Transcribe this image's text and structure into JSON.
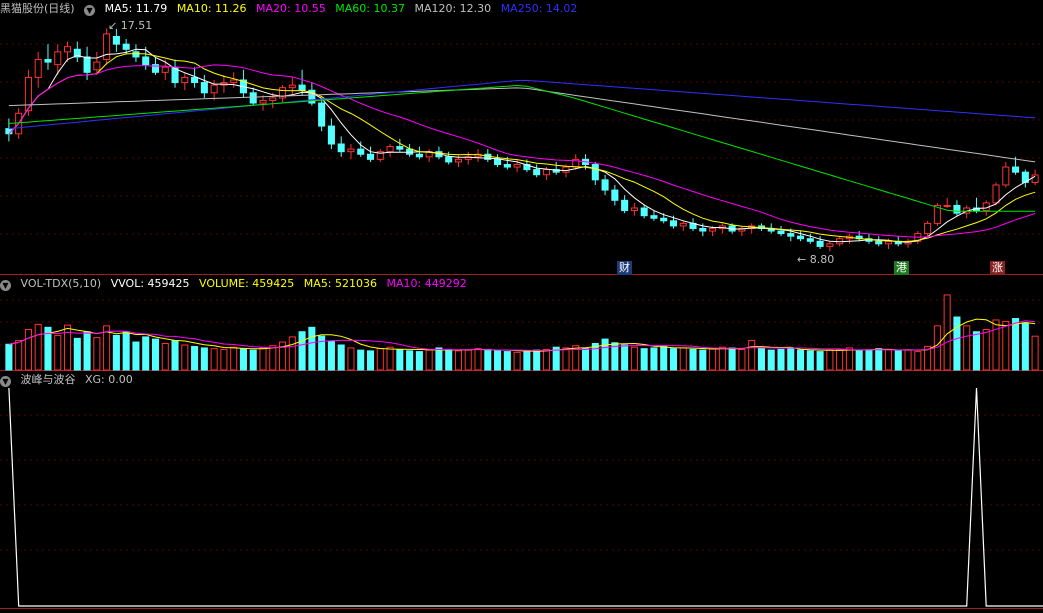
{
  "price_header": {
    "title": "黑猫股份(日线)",
    "ma5": "MA5: 11.79",
    "ma10": "MA10: 11.26",
    "ma20": "MA20: 10.55",
    "ma60": "MA60: 10.37",
    "ma120": "MA120: 12.30",
    "ma250": "MA250: 14.02"
  },
  "vol_header": {
    "title": "VOL-TDX(5,10)",
    "vvol": "VVOL: 459425",
    "volume": "VOLUME: 459425",
    "ma5": "MA5: 521036",
    "ma10": "MA10: 449292"
  },
  "ind_header": {
    "title": "波峰与波谷",
    "xg": "XG: 0.00"
  },
  "annotations": {
    "high_label": "17.51",
    "low_label": "8.80",
    "tag_cai": "财",
    "tag_gang": "港",
    "tag_zhang": "涨"
  },
  "colors": {
    "up": "#ff3232",
    "down": "#54ffff",
    "ma5": "#ffffff",
    "ma10": "#ffff00",
    "ma20": "#ff00ff",
    "ma60": "#00e600",
    "ma120": "#c0c0c0",
    "ma250": "#3030ff"
  },
  "chart_data": [
    {
      "type": "candlestick",
      "title": "黑猫股份(日线)",
      "annotations": {
        "high": 17.51,
        "low": 8.8
      },
      "ohlc": [
        [
          13.6,
          14.0,
          13.1,
          13.4
        ],
        [
          13.4,
          14.4,
          13.2,
          14.2
        ],
        [
          14.3,
          15.9,
          14.1,
          15.6
        ],
        [
          15.6,
          16.6,
          15.2,
          16.3
        ],
        [
          16.3,
          16.9,
          15.9,
          16.2
        ],
        [
          16.1,
          16.9,
          15.7,
          16.6
        ],
        [
          16.6,
          17.0,
          16.2,
          16.8
        ],
        [
          16.7,
          17.0,
          16.2,
          16.4
        ],
        [
          16.4,
          16.8,
          15.5,
          15.8
        ],
        [
          15.9,
          16.6,
          15.7,
          16.2
        ],
        [
          16.3,
          17.51,
          16.1,
          17.3
        ],
        [
          17.2,
          17.5,
          16.6,
          16.9
        ],
        [
          16.9,
          17.1,
          16.5,
          16.7
        ],
        [
          16.6,
          16.9,
          16.2,
          16.4
        ],
        [
          16.4,
          16.8,
          15.9,
          16.1
        ],
        [
          16.1,
          16.4,
          15.7,
          15.8
        ],
        [
          15.8,
          16.3,
          15.5,
          16.0
        ],
        [
          16.0,
          16.3,
          15.2,
          15.4
        ],
        [
          15.4,
          15.8,
          15.1,
          15.6
        ],
        [
          15.6,
          16.0,
          15.2,
          15.4
        ],
        [
          15.4,
          15.7,
          14.8,
          15.0
        ],
        [
          15.0,
          15.5,
          14.7,
          15.3
        ],
        [
          15.3,
          15.7,
          15.0,
          15.4
        ],
        [
          15.4,
          15.8,
          15.2,
          15.5
        ],
        [
          15.5,
          15.9,
          14.8,
          15.0
        ],
        [
          15.0,
          15.2,
          14.5,
          14.6
        ],
        [
          14.6,
          14.9,
          14.3,
          14.7
        ],
        [
          14.7,
          15.0,
          14.4,
          14.8
        ],
        [
          14.8,
          15.3,
          14.6,
          15.2
        ],
        [
          15.2,
          15.6,
          14.9,
          15.3
        ],
        [
          15.3,
          15.9,
          14.9,
          15.1
        ],
        [
          15.1,
          15.4,
          14.5,
          14.6
        ],
        [
          14.6,
          14.8,
          13.5,
          13.7
        ],
        [
          13.7,
          14.0,
          12.8,
          13.0
        ],
        [
          13.0,
          13.3,
          12.5,
          12.7
        ],
        [
          12.7,
          13.0,
          12.4,
          12.8
        ],
        [
          12.8,
          13.1,
          12.5,
          12.6
        ],
        [
          12.6,
          12.9,
          12.3,
          12.4
        ],
        [
          12.4,
          12.8,
          12.3,
          12.7
        ],
        [
          12.7,
          13.0,
          12.5,
          12.9
        ],
        [
          12.9,
          13.2,
          12.7,
          12.8
        ],
        [
          12.8,
          13.0,
          12.5,
          12.6
        ],
        [
          12.6,
          12.9,
          12.4,
          12.5
        ],
        [
          12.5,
          12.8,
          12.3,
          12.7
        ],
        [
          12.7,
          12.9,
          12.4,
          12.5
        ],
        [
          12.5,
          12.7,
          12.2,
          12.3
        ],
        [
          12.3,
          12.6,
          12.1,
          12.4
        ],
        [
          12.4,
          12.7,
          12.2,
          12.5
        ],
        [
          12.5,
          12.8,
          12.3,
          12.6
        ],
        [
          12.6,
          12.8,
          12.3,
          12.4
        ],
        [
          12.4,
          12.6,
          12.1,
          12.2
        ],
        [
          12.2,
          12.5,
          12.0,
          12.1
        ],
        [
          12.1,
          12.4,
          11.9,
          12.2
        ],
        [
          12.2,
          12.4,
          11.9,
          12.0
        ],
        [
          12.0,
          12.2,
          11.7,
          11.8
        ],
        [
          11.8,
          12.1,
          11.6,
          12.0
        ],
        [
          12.0,
          12.3,
          11.8,
          11.9
        ],
        [
          11.9,
          12.2,
          11.7,
          12.1
        ],
        [
          12.1,
          12.6,
          12.0,
          12.4
        ],
        [
          12.4,
          12.6,
          12.0,
          12.2
        ],
        [
          12.2,
          12.3,
          11.4,
          11.6
        ],
        [
          11.6,
          11.8,
          11.0,
          11.2
        ],
        [
          11.2,
          11.4,
          10.6,
          10.8
        ],
        [
          10.8,
          11.0,
          10.3,
          10.4
        ],
        [
          10.4,
          10.7,
          10.2,
          10.5
        ],
        [
          10.5,
          10.6,
          10.1,
          10.2
        ],
        [
          10.2,
          10.4,
          10.0,
          10.1
        ],
        [
          10.1,
          10.3,
          9.9,
          10.0
        ],
        [
          10.0,
          10.2,
          9.7,
          9.8
        ],
        [
          9.8,
          10.0,
          9.6,
          9.9
        ],
        [
          9.9,
          10.1,
          9.6,
          9.7
        ],
        [
          9.7,
          9.9,
          9.4,
          9.6
        ],
        [
          9.6,
          9.8,
          9.4,
          9.7
        ],
        [
          9.7,
          9.9,
          9.5,
          9.8
        ],
        [
          9.8,
          9.9,
          9.5,
          9.6
        ],
        [
          9.6,
          9.8,
          9.4,
          9.7
        ],
        [
          9.7,
          9.9,
          9.5,
          9.8
        ],
        [
          9.8,
          9.9,
          9.6,
          9.7
        ],
        [
          9.7,
          9.9,
          9.5,
          9.6
        ],
        [
          9.6,
          9.8,
          9.4,
          9.5
        ],
        [
          9.5,
          9.7,
          9.2,
          9.4
        ],
        [
          9.4,
          9.6,
          9.2,
          9.3
        ],
        [
          9.3,
          9.5,
          9.1,
          9.2
        ],
        [
          9.2,
          9.4,
          8.9,
          9.0
        ],
        [
          9.0,
          9.2,
          8.8,
          9.1
        ],
        [
          9.1,
          9.4,
          9.0,
          9.3
        ],
        [
          9.3,
          9.5,
          9.1,
          9.4
        ],
        [
          9.4,
          9.6,
          9.2,
          9.3
        ],
        [
          9.3,
          9.5,
          9.1,
          9.2
        ],
        [
          9.2,
          9.4,
          9.0,
          9.1
        ],
        [
          9.1,
          9.3,
          8.9,
          9.2
        ],
        [
          9.2,
          9.4,
          9.0,
          9.1
        ],
        [
          9.1,
          9.3,
          8.95,
          9.2
        ],
        [
          9.2,
          9.6,
          9.1,
          9.5
        ],
        [
          9.5,
          10.0,
          9.4,
          9.9
        ],
        [
          9.9,
          10.7,
          9.8,
          10.6
        ],
        [
          10.6,
          10.9,
          10.5,
          10.6
        ],
        [
          10.6,
          10.8,
          10.2,
          10.3
        ],
        [
          10.3,
          10.6,
          10.1,
          10.5
        ],
        [
          10.5,
          10.9,
          10.3,
          10.4
        ],
        [
          10.4,
          10.8,
          10.2,
          10.7
        ],
        [
          10.7,
          11.5,
          10.6,
          11.4
        ],
        [
          11.4,
          12.3,
          11.3,
          12.1
        ],
        [
          12.1,
          12.5,
          11.8,
          11.9
        ],
        [
          11.9,
          12.0,
          11.3,
          11.5
        ],
        [
          11.5,
          12.0,
          11.4,
          11.79
        ]
      ],
      "ma_periods": [
        5,
        10,
        20,
        60,
        120,
        250
      ],
      "ma_latest": {
        "MA5": 11.79,
        "MA10": 11.26,
        "MA20": 10.55,
        "MA60": 10.37,
        "MA120": 12.3,
        "MA250": 14.02
      }
    },
    {
      "type": "bar",
      "title": "VOL-TDX(5,10)",
      "values": [
        350000,
        400000,
        550000,
        620000,
        580000,
        470000,
        610000,
        430000,
        520000,
        440000,
        600000,
        470000,
        520000,
        380000,
        450000,
        420000,
        360000,
        400000,
        340000,
        320000,
        300000,
        290000,
        280000,
        310000,
        290000,
        270000,
        300000,
        330000,
        380000,
        450000,
        520000,
        580000,
        460000,
        390000,
        340000,
        300000,
        270000,
        260000,
        290000,
        310000,
        280000,
        260000,
        250000,
        270000,
        300000,
        280000,
        260000,
        270000,
        290000,
        280000,
        260000,
        250000,
        240000,
        260000,
        270000,
        280000,
        310000,
        300000,
        330000,
        290000,
        360000,
        420000,
        370000,
        340000,
        310000,
        290000,
        300000,
        320000,
        290000,
        300000,
        280000,
        270000,
        290000,
        310000,
        300000,
        280000,
        400000,
        300000,
        270000,
        280000,
        290000,
        270000,
        260000,
        250000,
        270000,
        280000,
        300000,
        260000,
        270000,
        290000,
        280000,
        260000,
        270000,
        250000,
        320000,
        600000,
        1020000,
        720000,
        600000,
        520000,
        550000,
        680000,
        660000,
        700000,
        640000,
        459425
      ],
      "ma_latest": {
        "MA5": 521036,
        "MA10": 449292
      }
    },
    {
      "type": "line",
      "title": "波峰与波谷",
      "values_xg": [
        1,
        0,
        0,
        0,
        0,
        0,
        0,
        0,
        0,
        0,
        0,
        0,
        0,
        0,
        0,
        0,
        0,
        0,
        0,
        0,
        0,
        0,
        0,
        0,
        0,
        0,
        0,
        0,
        0,
        0,
        0,
        0,
        0,
        0,
        0,
        0,
        0,
        0,
        0,
        0,
        0,
        0,
        0,
        0,
        0,
        0,
        0,
        0,
        0,
        0,
        0,
        0,
        0,
        0,
        0,
        0,
        0,
        0,
        0,
        0,
        0,
        0,
        0,
        0,
        0,
        0,
        0,
        0,
        0,
        0,
        0,
        0,
        0,
        0,
        0,
        0,
        0,
        0,
        0,
        0,
        0,
        0,
        0,
        0,
        0,
        0,
        0,
        0,
        0,
        0,
        0,
        0,
        0,
        0,
        0,
        0,
        0,
        0,
        0,
        1,
        0,
        0,
        0,
        0,
        0,
        0,
        0,
        0,
        1,
        0,
        0,
        0
      ],
      "latest": 0
    }
  ]
}
